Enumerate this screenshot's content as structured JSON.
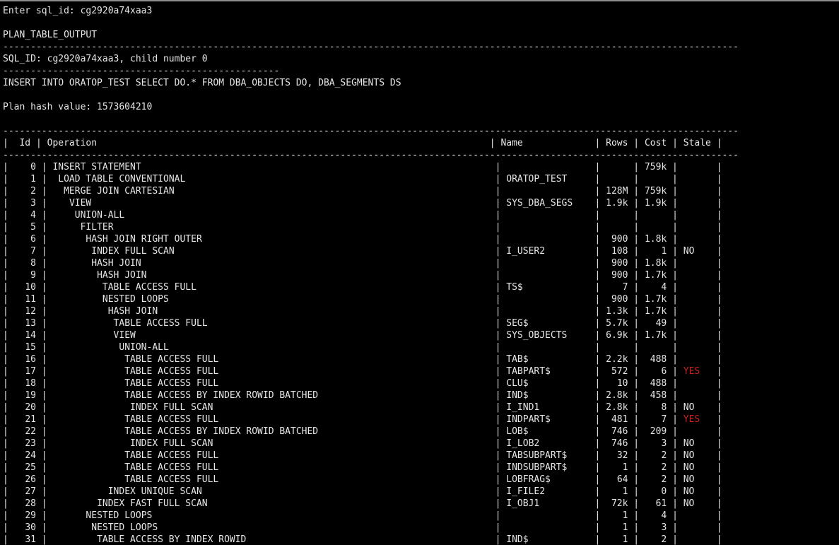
{
  "colors": {
    "background": "#000000",
    "text": "#e6e6e6",
    "stale_yes": "#cc2020"
  },
  "header": {
    "prompt": "Enter sql_id: cg2920a74xaa3",
    "output_title": "PLAN_TABLE_OUTPUT",
    "sql_info": "SQL_ID: cg2920a74xaa3, child number 0",
    "sql_text": "INSERT INTO ORATOP_TEST SELECT DO.* FROM DBA_OBJECTS DO, DBA_SEGMENTS DS",
    "plan_hash": "Plan hash value: 1573604210"
  },
  "plan_table": {
    "columns": [
      "Id",
      "Operation",
      "Name",
      "Rows",
      "Cost",
      "Stale"
    ],
    "rows": [
      {
        "id": "0",
        "indent": 0,
        "operation": "INSERT STATEMENT",
        "name": "",
        "rows": "",
        "cost": "759k",
        "stale": ""
      },
      {
        "id": "1",
        "indent": 1,
        "operation": "LOAD TABLE CONVENTIONAL",
        "name": "ORATOP_TEST",
        "rows": "",
        "cost": "",
        "stale": ""
      },
      {
        "id": "2",
        "indent": 2,
        "operation": "MERGE JOIN CARTESIAN",
        "name": "",
        "rows": "128M",
        "cost": "759k",
        "stale": ""
      },
      {
        "id": "3",
        "indent": 3,
        "operation": "VIEW",
        "name": "SYS_DBA_SEGS",
        "rows": "1.9k",
        "cost": "1.9k",
        "stale": ""
      },
      {
        "id": "4",
        "indent": 4,
        "operation": "UNION-ALL",
        "name": "",
        "rows": "",
        "cost": "",
        "stale": ""
      },
      {
        "id": "5",
        "indent": 5,
        "operation": "FILTER",
        "name": "",
        "rows": "",
        "cost": "",
        "stale": ""
      },
      {
        "id": "6",
        "indent": 6,
        "operation": "HASH JOIN RIGHT OUTER",
        "name": "",
        "rows": "900",
        "cost": "1.8k",
        "stale": ""
      },
      {
        "id": "7",
        "indent": 7,
        "operation": "INDEX FULL SCAN",
        "name": "I_USER2",
        "rows": "108",
        "cost": "1",
        "stale": "NO"
      },
      {
        "id": "8",
        "indent": 7,
        "operation": "HASH JOIN",
        "name": "",
        "rows": "900",
        "cost": "1.8k",
        "stale": ""
      },
      {
        "id": "9",
        "indent": 8,
        "operation": "HASH JOIN",
        "name": "",
        "rows": "900",
        "cost": "1.7k",
        "stale": ""
      },
      {
        "id": "10",
        "indent": 9,
        "operation": "TABLE ACCESS FULL",
        "name": "TS$",
        "rows": "7",
        "cost": "4",
        "stale": ""
      },
      {
        "id": "11",
        "indent": 9,
        "operation": "NESTED LOOPS",
        "name": "",
        "rows": "900",
        "cost": "1.7k",
        "stale": ""
      },
      {
        "id": "12",
        "indent": 10,
        "operation": "HASH JOIN",
        "name": "",
        "rows": "1.3k",
        "cost": "1.7k",
        "stale": ""
      },
      {
        "id": "13",
        "indent": 11,
        "operation": "TABLE ACCESS FULL",
        "name": "SEG$",
        "rows": "5.7k",
        "cost": "49",
        "stale": ""
      },
      {
        "id": "14",
        "indent": 11,
        "operation": "VIEW",
        "name": "SYS_OBJECTS",
        "rows": "6.9k",
        "cost": "1.7k",
        "stale": ""
      },
      {
        "id": "15",
        "indent": 12,
        "operation": "UNION-ALL",
        "name": "",
        "rows": "",
        "cost": "",
        "stale": ""
      },
      {
        "id": "16",
        "indent": 13,
        "operation": "TABLE ACCESS FULL",
        "name": "TAB$",
        "rows": "2.2k",
        "cost": "488",
        "stale": ""
      },
      {
        "id": "17",
        "indent": 13,
        "operation": "TABLE ACCESS FULL",
        "name": "TABPART$",
        "rows": "572",
        "cost": "6",
        "stale": "YES"
      },
      {
        "id": "18",
        "indent": 13,
        "operation": "TABLE ACCESS FULL",
        "name": "CLU$",
        "rows": "10",
        "cost": "488",
        "stale": ""
      },
      {
        "id": "19",
        "indent": 13,
        "operation": "TABLE ACCESS BY INDEX ROWID BATCHED",
        "name": "IND$",
        "rows": "2.8k",
        "cost": "458",
        "stale": ""
      },
      {
        "id": "20",
        "indent": 14,
        "operation": "INDEX FULL SCAN",
        "name": "I_IND1",
        "rows": "2.8k",
        "cost": "8",
        "stale": "NO"
      },
      {
        "id": "21",
        "indent": 13,
        "operation": "TABLE ACCESS FULL",
        "name": "INDPART$",
        "rows": "481",
        "cost": "7",
        "stale": "YES"
      },
      {
        "id": "22",
        "indent": 13,
        "operation": "TABLE ACCESS BY INDEX ROWID BATCHED",
        "name": "LOB$",
        "rows": "746",
        "cost": "209",
        "stale": ""
      },
      {
        "id": "23",
        "indent": 14,
        "operation": "INDEX FULL SCAN",
        "name": "I_LOB2",
        "rows": "746",
        "cost": "3",
        "stale": "NO"
      },
      {
        "id": "24",
        "indent": 13,
        "operation": "TABLE ACCESS FULL",
        "name": "TABSUBPART$",
        "rows": "32",
        "cost": "2",
        "stale": "NO"
      },
      {
        "id": "25",
        "indent": 13,
        "operation": "TABLE ACCESS FULL",
        "name": "INDSUBPART$",
        "rows": "1",
        "cost": "2",
        "stale": "NO"
      },
      {
        "id": "26",
        "indent": 13,
        "operation": "TABLE ACCESS FULL",
        "name": "LOBFRAG$",
        "rows": "64",
        "cost": "2",
        "stale": "NO"
      },
      {
        "id": "27",
        "indent": 10,
        "operation": "INDEX UNIQUE SCAN",
        "name": "I_FILE2",
        "rows": "1",
        "cost": "0",
        "stale": "NO"
      },
      {
        "id": "28",
        "indent": 8,
        "operation": "INDEX FAST FULL SCAN",
        "name": "I_OBJ1",
        "rows": "72k",
        "cost": "61",
        "stale": "NO"
      },
      {
        "id": "29",
        "indent": 6,
        "operation": "NESTED LOOPS",
        "name": "",
        "rows": "1",
        "cost": "4",
        "stale": ""
      },
      {
        "id": "30",
        "indent": 7,
        "operation": "NESTED LOOPS",
        "name": "",
        "rows": "1",
        "cost": "3",
        "stale": ""
      },
      {
        "id": "31",
        "indent": 8,
        "operation": "TABLE ACCESS BY INDEX ROWID",
        "name": "IND$",
        "rows": "1",
        "cost": "2",
        "stale": ""
      }
    ]
  }
}
